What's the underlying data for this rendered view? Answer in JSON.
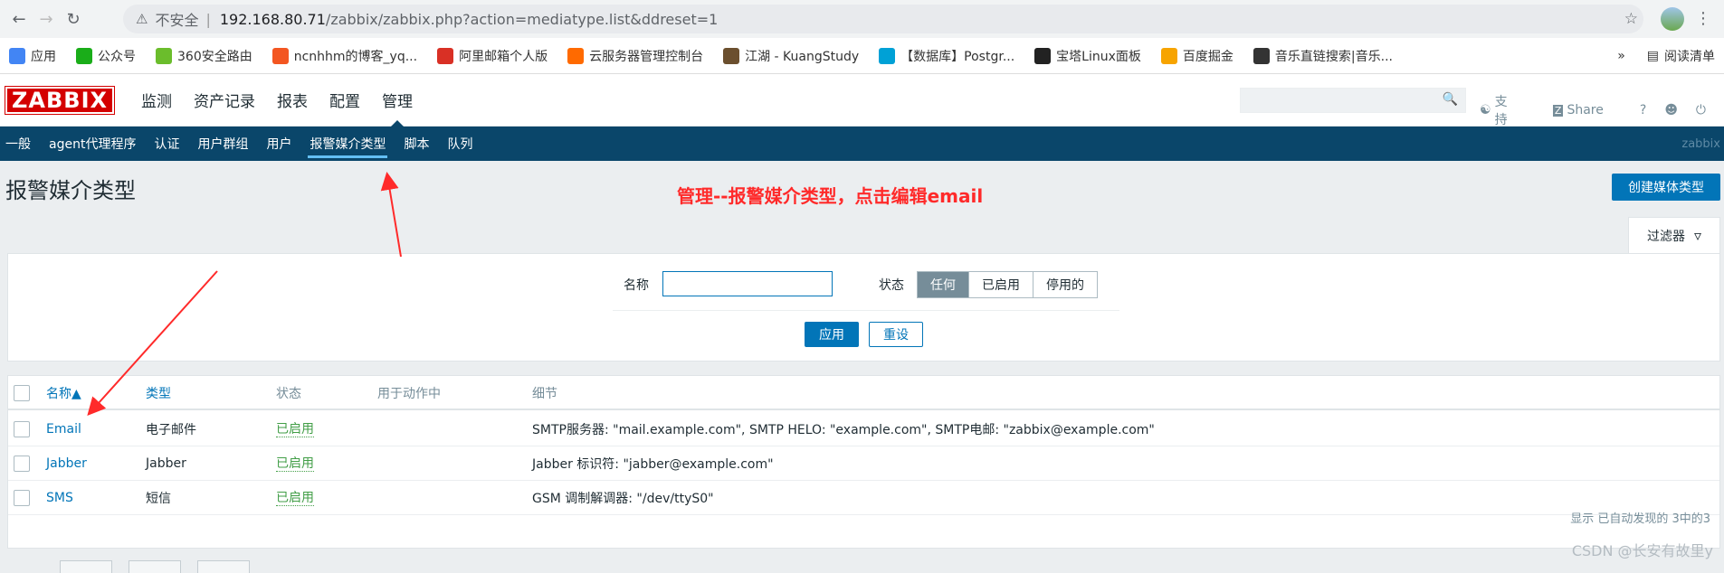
{
  "browser": {
    "insecure_label": "不安全",
    "url_host": "192.168.80.71",
    "url_path": "/zabbix/zabbix.php?action=mediatype.list&ddreset=1"
  },
  "bookmarks": [
    {
      "label": "应用",
      "color": "#4285f4"
    },
    {
      "label": "公众号",
      "color": "#1aad19"
    },
    {
      "label": "360安全路由",
      "color": "#6bbd2c"
    },
    {
      "label": "ncnhhm的博客_yq...",
      "color": "#f35621"
    },
    {
      "label": "阿里邮箱个人版",
      "color": "#d93025"
    },
    {
      "label": "云服务器管理控制台",
      "color": "#ff6a00"
    },
    {
      "label": "江湖 - KuangStudy",
      "color": "#6b4f2e"
    },
    {
      "label": "【数据库】Postgr...",
      "color": "#00a1d6"
    },
    {
      "label": "宝塔Linux面板",
      "color": "#222222"
    },
    {
      "label": "百度掘金",
      "color": "#f7a400"
    },
    {
      "label": "音乐直链搜索|音乐...",
      "color": "#333333"
    }
  ],
  "bookmarks_more": "»",
  "reading_list": "阅读清单",
  "header": {
    "logo": "ZABBIX",
    "nav": [
      "监测",
      "资产记录",
      "报表",
      "配置",
      "管理"
    ],
    "active_nav": "管理",
    "support": "支持",
    "share": "Share",
    "help": "?"
  },
  "subnav": {
    "items": [
      "一般",
      "agent代理程序",
      "认证",
      "用户群组",
      "用户",
      "报警媒介类型",
      "脚本",
      "队列"
    ],
    "active": "报警媒介类型",
    "brand": "zabbix"
  },
  "page": {
    "title": "报警媒介类型",
    "create_button": "创建媒体类型",
    "annotation": "管理--报警媒介类型，点击编辑email"
  },
  "filter": {
    "tab_label": "过滤器",
    "name_label": "名称",
    "name_value": "",
    "status_label": "状态",
    "status_options": [
      "任何",
      "已启用",
      "停用的"
    ],
    "status_selected": "任何",
    "apply": "应用",
    "reset": "重设"
  },
  "table": {
    "columns": [
      "名称▲",
      "类型",
      "状态",
      "用于动作中",
      "细节"
    ],
    "rows": [
      {
        "name": "Email",
        "type": "电子邮件",
        "status": "已启用",
        "used_in_actions": "",
        "details": "SMTP服务器: \"mail.example.com\", SMTP HELO: \"example.com\", SMTP电邮: \"zabbix@example.com\""
      },
      {
        "name": "Jabber",
        "type": "Jabber",
        "status": "已启用",
        "used_in_actions": "",
        "details": "Jabber 标识符: \"jabber@example.com\""
      },
      {
        "name": "SMS",
        "type": "短信",
        "status": "已启用",
        "used_in_actions": "",
        "details": "GSM 调制解调器: \"/dev/ttyS0\""
      }
    ],
    "footer": "显示 已自动发现的 3中的3"
  },
  "watermark": "CSDN @长安有故里y",
  "colors": {
    "logo_red": "#d40000",
    "nav_blue": "#0a466a",
    "primary": "#0275b8",
    "enabled_green": "#429e47",
    "annotation_red": "#ff2a2a"
  }
}
